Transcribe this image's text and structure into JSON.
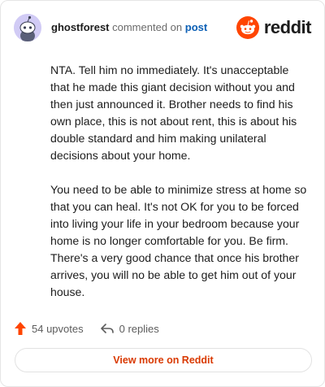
{
  "comment": {
    "username": "ghostforest",
    "commented_text": "commented on",
    "post_link": "post",
    "paragraphs": [
      "NTA. Tell him no immediately. It's unacceptable that he made this giant decision without you and then just announced it. Brother needs to find his own place, this is not about rent, this is about his double standard and him making unilateral decisions about your home.",
      "You need to be able to minimize stress at home so that you can heal. It's not OK for you to be forced into living your life in your bedroom because your home is no longer comfortable for you. Be firm. There's a very good chance that once his brother arrives, you will no be able to get him out of your house."
    ]
  },
  "brand": {
    "wordmark": "reddit",
    "color": "#ff4500",
    "icon": "reddit-logo-icon"
  },
  "actions": {
    "upvotes_label": "54 upvotes",
    "upvote_color": "#ff4500",
    "replies_label": "0 replies"
  },
  "footer": {
    "view_more_label": "View more on Reddit",
    "link_color": "#d93900"
  }
}
